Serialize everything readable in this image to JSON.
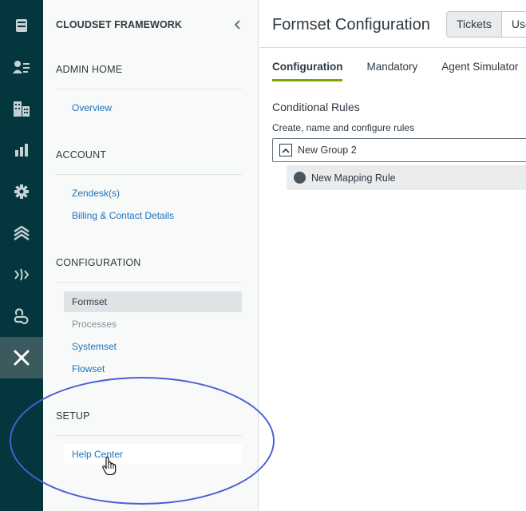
{
  "rail": {
    "items": [
      {
        "icon": "inbox-icon"
      },
      {
        "icon": "users-list-icon"
      },
      {
        "icon": "buildings-icon"
      },
      {
        "icon": "reports-icon"
      },
      {
        "icon": "settings-gear-icon"
      },
      {
        "icon": "layers-icon"
      },
      {
        "icon": "flow-icon"
      },
      {
        "icon": "apps-icon"
      },
      {
        "icon": "cloudset-logo-icon"
      }
    ],
    "active_index": 8,
    "background": "#03363d",
    "active_background": "#3b5a5e"
  },
  "nav": {
    "title": "CLOUDSET FRAMEWORK",
    "collapse_icon": "chevron-left-icon",
    "sections": {
      "admin_home": {
        "heading": "ADMIN HOME",
        "items": [
          {
            "label": "Overview"
          }
        ]
      },
      "account": {
        "heading": "ACCOUNT",
        "items": [
          {
            "label": "Zendesk(s)"
          },
          {
            "label": "Billing & Contact Details"
          }
        ]
      },
      "configuration": {
        "heading": "CONFIGURATION",
        "items": [
          {
            "label": "Formset",
            "state": "selected"
          },
          {
            "label": "Processes",
            "state": "disabled"
          },
          {
            "label": "Systemset"
          },
          {
            "label": "Flowset"
          }
        ]
      },
      "setup": {
        "heading": "SETUP",
        "items": [
          {
            "label": "Help Center",
            "state": "hovered"
          }
        ]
      }
    },
    "link_color": "#1f73b7"
  },
  "main": {
    "title": "Formset Configuration",
    "segments": [
      {
        "label": "Tickets",
        "active": true
      },
      {
        "label": "Users",
        "active": false
      }
    ],
    "tabs": [
      {
        "label": "Configuration",
        "active": true
      },
      {
        "label": "Mandatory"
      },
      {
        "label": "Agent Simulator"
      }
    ],
    "accent": "#78a300",
    "conditional_rules": {
      "title": "Conditional Rules",
      "subtitle": "Create, name and configure rules",
      "group": {
        "name": "New Group 2",
        "toggle_icon": "chevron-up-icon"
      },
      "rule": {
        "name": "New Mapping Rule",
        "status_icon": "circle-icon"
      }
    }
  },
  "annotation": {
    "highlight": "ellipse",
    "color": "#4a5fd8",
    "cursor": "hand-pointer-icon"
  }
}
